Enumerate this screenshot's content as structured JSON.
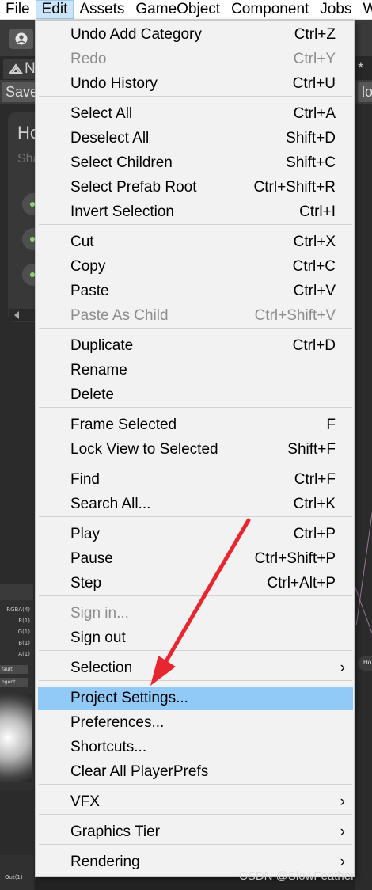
{
  "menubar": {
    "items": [
      "File",
      "Edit",
      "Assets",
      "GameObject",
      "Component",
      "Jobs",
      "W"
    ]
  },
  "background": {
    "tab_label": "N",
    "tab_modified_marker": "*",
    "save_label": "Save",
    "right_button_label": "lo",
    "blackboard_title": "Ho",
    "blackboard_subtitle": "Sha",
    "node_ports": [
      "RGBA(4)",
      "R(1)",
      "G(1)",
      "B(1)",
      "A(1)"
    ],
    "node_dropdowns": [
      "fault",
      "ngent"
    ],
    "output_port": "Out(1)",
    "right_pill_label": "Ho"
  },
  "edit_menu": {
    "items": [
      {
        "label": "Undo Add Category",
        "shortcut": "Ctrl+Z",
        "enabled": true
      },
      {
        "label": "Redo",
        "shortcut": "Ctrl+Y",
        "enabled": false
      },
      {
        "label": "Undo History",
        "shortcut": "Ctrl+U",
        "enabled": true
      },
      {
        "label": "Select All",
        "shortcut": "Ctrl+A",
        "enabled": true
      },
      {
        "label": "Deselect All",
        "shortcut": "Shift+D",
        "enabled": true
      },
      {
        "label": "Select Children",
        "shortcut": "Shift+C",
        "enabled": true
      },
      {
        "label": "Select Prefab Root",
        "shortcut": "Ctrl+Shift+R",
        "enabled": true
      },
      {
        "label": "Invert Selection",
        "shortcut": "Ctrl+I",
        "enabled": true
      },
      {
        "label": "Cut",
        "shortcut": "Ctrl+X",
        "enabled": true
      },
      {
        "label": "Copy",
        "shortcut": "Ctrl+C",
        "enabled": true
      },
      {
        "label": "Paste",
        "shortcut": "Ctrl+V",
        "enabled": true
      },
      {
        "label": "Paste As Child",
        "shortcut": "Ctrl+Shift+V",
        "enabled": false
      },
      {
        "label": "Duplicate",
        "shortcut": "Ctrl+D",
        "enabled": true
      },
      {
        "label": "Rename",
        "shortcut": "",
        "enabled": true
      },
      {
        "label": "Delete",
        "shortcut": "",
        "enabled": true
      },
      {
        "label": "Frame Selected",
        "shortcut": "F",
        "enabled": true
      },
      {
        "label": "Lock View to Selected",
        "shortcut": "Shift+F",
        "enabled": true
      },
      {
        "label": "Find",
        "shortcut": "Ctrl+F",
        "enabled": true
      },
      {
        "label": "Search All...",
        "shortcut": "Ctrl+K",
        "enabled": true
      },
      {
        "label": "Play",
        "shortcut": "Ctrl+P",
        "enabled": true
      },
      {
        "label": "Pause",
        "shortcut": "Ctrl+Shift+P",
        "enabled": true
      },
      {
        "label": "Step",
        "shortcut": "Ctrl+Alt+P",
        "enabled": true
      },
      {
        "label": "Sign in...",
        "shortcut": "",
        "enabled": false
      },
      {
        "label": "Sign out",
        "shortcut": "",
        "enabled": true
      },
      {
        "label": "Selection",
        "shortcut": "",
        "enabled": true,
        "submenu": true
      },
      {
        "label": "Project Settings...",
        "shortcut": "",
        "enabled": true,
        "highlighted": true
      },
      {
        "label": "Preferences...",
        "shortcut": "",
        "enabled": true
      },
      {
        "label": "Shortcuts...",
        "shortcut": "",
        "enabled": true
      },
      {
        "label": "Clear All PlayerPrefs",
        "shortcut": "",
        "enabled": true
      },
      {
        "label": "VFX",
        "shortcut": "",
        "enabled": true,
        "submenu": true
      },
      {
        "label": "Graphics Tier",
        "shortcut": "",
        "enabled": true,
        "submenu": true
      },
      {
        "label": "Rendering",
        "shortcut": "",
        "enabled": true,
        "submenu": true
      }
    ],
    "submenu_glyph": "›"
  },
  "annotation": {
    "arrow_color": "#e8262f",
    "target": "Project Settings..."
  },
  "watermark": "CSDN @SlowFeather",
  "colors": {
    "highlight": "#91c9f7",
    "disabled_text": "#8d8d8d",
    "menu_bg": "#f2f2f2"
  }
}
